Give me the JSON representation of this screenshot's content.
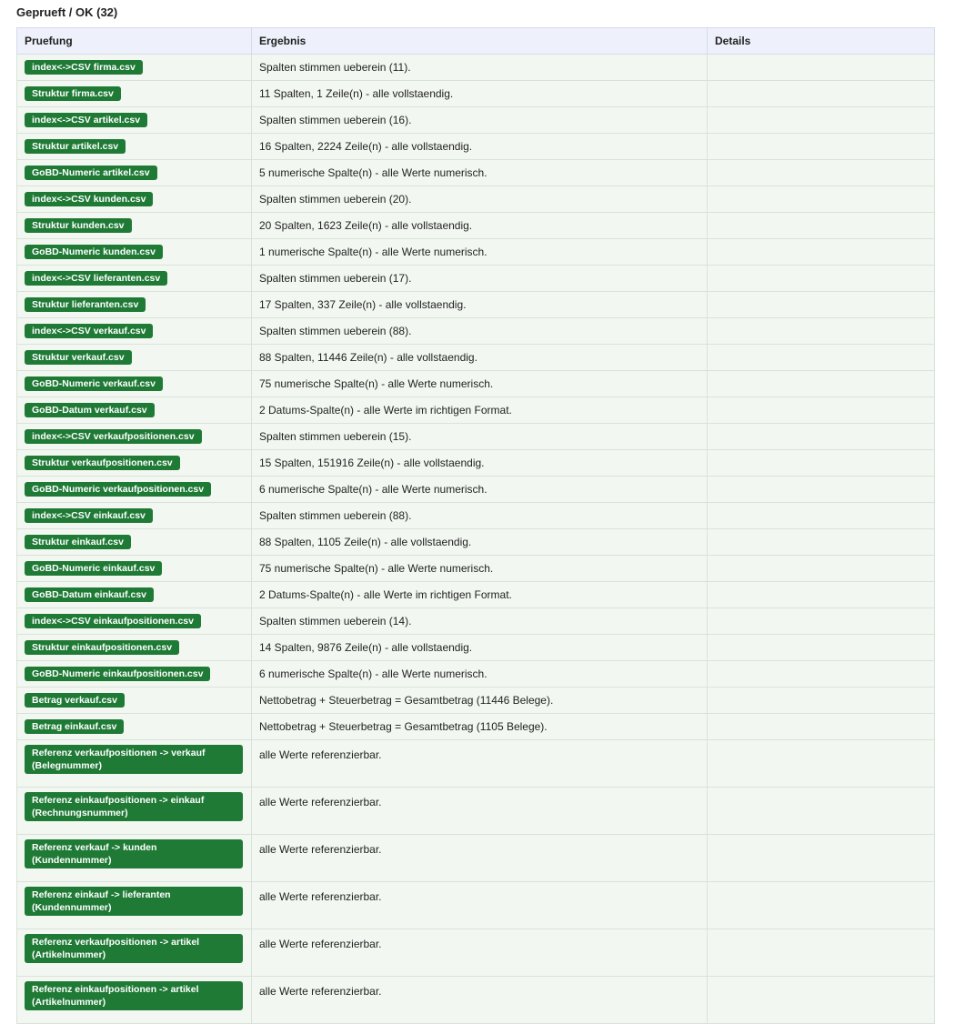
{
  "section": {
    "title": "Geprueft / OK (32)"
  },
  "table": {
    "headers": {
      "check": "Pruefung",
      "result": "Ergebnis",
      "details": "Details"
    },
    "rows": [
      {
        "check": "index<->CSV firma.csv",
        "result": "Spalten stimmen ueberein (11).",
        "details": ""
      },
      {
        "check": "Struktur firma.csv",
        "result": "11 Spalten, 1 Zeile(n) - alle vollstaendig.",
        "details": ""
      },
      {
        "check": "index<->CSV artikel.csv",
        "result": "Spalten stimmen ueberein (16).",
        "details": ""
      },
      {
        "check": "Struktur artikel.csv",
        "result": "16 Spalten, 2224 Zeile(n) - alle vollstaendig.",
        "details": ""
      },
      {
        "check": "GoBD-Numeric artikel.csv",
        "result": "5 numerische Spalte(n) - alle Werte numerisch.",
        "details": ""
      },
      {
        "check": "index<->CSV kunden.csv",
        "result": "Spalten stimmen ueberein (20).",
        "details": ""
      },
      {
        "check": "Struktur kunden.csv",
        "result": "20 Spalten, 1623 Zeile(n) - alle vollstaendig.",
        "details": ""
      },
      {
        "check": "GoBD-Numeric kunden.csv",
        "result": "1 numerische Spalte(n) - alle Werte numerisch.",
        "details": ""
      },
      {
        "check": "index<->CSV lieferanten.csv",
        "result": "Spalten stimmen ueberein (17).",
        "details": ""
      },
      {
        "check": "Struktur lieferanten.csv",
        "result": "17 Spalten, 337 Zeile(n) - alle vollstaendig.",
        "details": ""
      },
      {
        "check": "index<->CSV verkauf.csv",
        "result": "Spalten stimmen ueberein (88).",
        "details": ""
      },
      {
        "check": "Struktur verkauf.csv",
        "result": "88 Spalten, 11446 Zeile(n) - alle vollstaendig.",
        "details": ""
      },
      {
        "check": "GoBD-Numeric verkauf.csv",
        "result": "75 numerische Spalte(n) - alle Werte numerisch.",
        "details": ""
      },
      {
        "check": "GoBD-Datum verkauf.csv",
        "result": "2 Datums-Spalte(n) - alle Werte im richtigen Format.",
        "details": ""
      },
      {
        "check": "index<->CSV verkaufpositionen.csv",
        "result": "Spalten stimmen ueberein (15).",
        "details": ""
      },
      {
        "check": "Struktur verkaufpositionen.csv",
        "result": "15 Spalten, 151916 Zeile(n) - alle vollstaendig.",
        "details": ""
      },
      {
        "check": "GoBD-Numeric verkaufpositionen.csv",
        "result": "6 numerische Spalte(n) - alle Werte numerisch.",
        "details": ""
      },
      {
        "check": "index<->CSV einkauf.csv",
        "result": "Spalten stimmen ueberein (88).",
        "details": ""
      },
      {
        "check": "Struktur einkauf.csv",
        "result": "88 Spalten, 1105 Zeile(n) - alle vollstaendig.",
        "details": ""
      },
      {
        "check": "GoBD-Numeric einkauf.csv",
        "result": "75 numerische Spalte(n) - alle Werte numerisch.",
        "details": ""
      },
      {
        "check": "GoBD-Datum einkauf.csv",
        "result": "2 Datums-Spalte(n) - alle Werte im richtigen Format.",
        "details": ""
      },
      {
        "check": "index<->CSV einkaufpositionen.csv",
        "result": "Spalten stimmen ueberein (14).",
        "details": ""
      },
      {
        "check": "Struktur einkaufpositionen.csv",
        "result": "14 Spalten, 9876 Zeile(n) - alle vollstaendig.",
        "details": ""
      },
      {
        "check": "GoBD-Numeric einkaufpositionen.csv",
        "result": "6 numerische Spalte(n) - alle Werte numerisch.",
        "details": ""
      },
      {
        "check": "Betrag verkauf.csv",
        "result": "Nettobetrag + Steuerbetrag = Gesamtbetrag (11446 Belege).",
        "details": ""
      },
      {
        "check": "Betrag einkauf.csv",
        "result": "Nettobetrag + Steuerbetrag = Gesamtbetrag (1105 Belege).",
        "details": ""
      },
      {
        "check": "Referenz verkaufpositionen -> verkauf (Belegnummer)",
        "result": "alle Werte referenzierbar.",
        "details": ""
      },
      {
        "check": "Referenz einkaufpositionen -> einkauf (Rechnungsnummer)",
        "result": "alle Werte referenzierbar.",
        "details": ""
      },
      {
        "check": "Referenz verkauf -> kunden (Kundennummer)",
        "result": "alle Werte referenzierbar.",
        "details": ""
      },
      {
        "check": "Referenz einkauf -> lieferanten (Kundennummer)",
        "result": "alle Werte referenzierbar.",
        "details": ""
      },
      {
        "check": "Referenz verkaufpositionen -> artikel (Artikelnummer)",
        "result": "alle Werte referenzierbar.",
        "details": ""
      },
      {
        "check": "Referenz einkaufpositionen -> artikel (Artikelnummer)",
        "result": "alle Werte referenzierbar.",
        "details": ""
      }
    ]
  },
  "colors": {
    "badge": "#1f7a36",
    "row_background": "#f2f8f1",
    "header_background": "#eef1fb"
  }
}
